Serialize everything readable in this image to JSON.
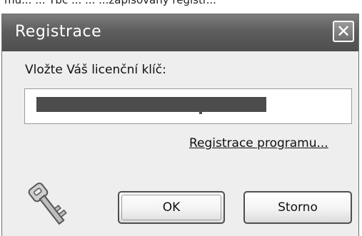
{
  "page_top_text": "mu... ... Tbč ... ... ...zapisovaný registr...",
  "dialog": {
    "title": "Registrace",
    "close_icon": "close-icon",
    "prompt_label": "Vložte Váš licenční klíč:",
    "license_key_value": "",
    "register_link": "Registrace programu...",
    "ok_label": "OK",
    "cancel_label": "Storno",
    "key_icon": "key-icon"
  }
}
